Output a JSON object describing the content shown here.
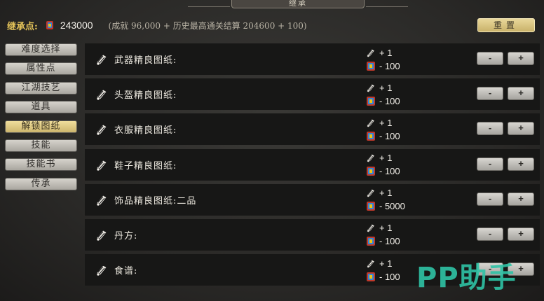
{
  "banner": {
    "title": "继承"
  },
  "header": {
    "points_label": "继承点:",
    "points_value": "243000",
    "points_note": "(成就 96,000 + 历史最高通关结算 204600 + 100)",
    "reset_label": "重置"
  },
  "sidebar": {
    "items": [
      {
        "label": "难度选择"
      },
      {
        "label": "属性点"
      },
      {
        "label": "江湖技艺"
      },
      {
        "label": "道具"
      },
      {
        "label": "解锁图纸"
      },
      {
        "label": "技能"
      },
      {
        "label": "技能书"
      },
      {
        "label": "传承"
      }
    ],
    "active_index": 4
  },
  "rows": [
    {
      "name": "武器精良图纸:",
      "gain": "+ 1",
      "cost": "- 100"
    },
    {
      "name": "头盔精良图纸:",
      "gain": "+ 1",
      "cost": "- 100"
    },
    {
      "name": "衣服精良图纸:",
      "gain": "+ 1",
      "cost": "- 100"
    },
    {
      "name": "鞋子精良图纸:",
      "gain": "+ 1",
      "cost": "- 100"
    },
    {
      "name": "饰品精良图纸:二品",
      "gain": "+ 1",
      "cost": "- 5000"
    },
    {
      "name": "丹方:",
      "gain": "+ 1",
      "cost": "- 100"
    },
    {
      "name": "食谱:",
      "gain": "+ 1",
      "cost": "- 100"
    }
  ],
  "buttons": {
    "minus": "-",
    "plus": "+"
  },
  "icons": {
    "points": "gem-icon",
    "row": "scroll-blueprint-icon",
    "gain": "scroll-blueprint-icon",
    "cost": "gem-icon"
  },
  "watermark": "PP助手",
  "colors": {
    "accent_gold": "#e6c55a",
    "watermark": "#2fc3a6",
    "active_tab": "#e9d79a"
  }
}
